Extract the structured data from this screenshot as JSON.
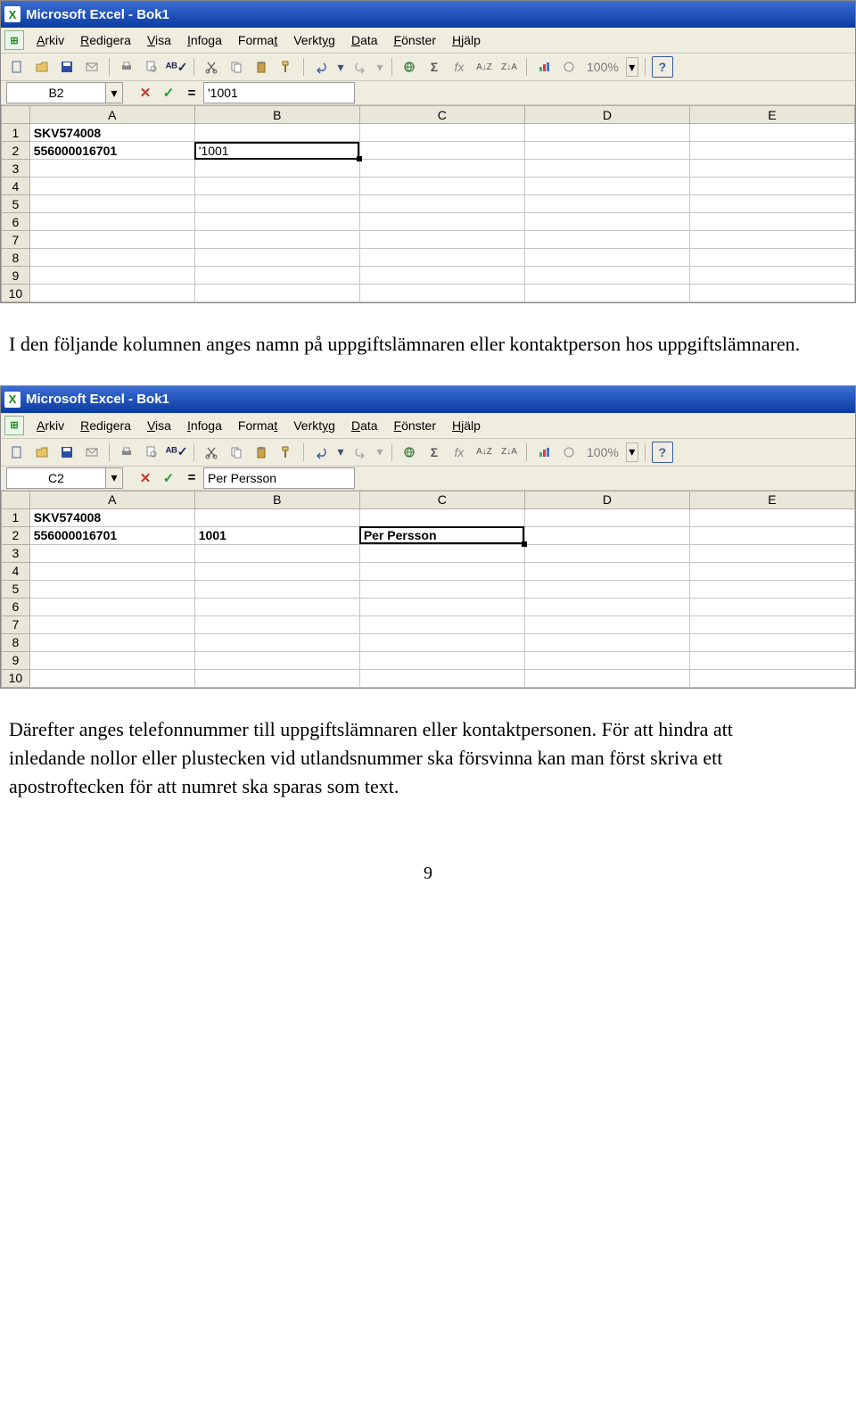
{
  "excel1": {
    "title": "Microsoft Excel - Bok1",
    "menus": [
      "Arkiv",
      "Redigera",
      "Visa",
      "Infoga",
      "Format",
      "Verktyg",
      "Data",
      "Fönster",
      "Hjälp"
    ],
    "zoom": "100%",
    "namebox": "B2",
    "formula": "'1001",
    "columns": [
      "A",
      "B",
      "C",
      "D",
      "E"
    ],
    "rows": [
      "1",
      "2",
      "3",
      "4",
      "5",
      "6",
      "7",
      "8",
      "9",
      "10"
    ],
    "cells": {
      "A1": "SKV574008",
      "A2": "556000016701",
      "B2": "'1001"
    },
    "active": "B2"
  },
  "para1": "I den följande kolumnen anges namn på uppgiftslämnaren eller kontaktperson hos uppgiftslämnaren.",
  "excel2": {
    "title": "Microsoft Excel - Bok1",
    "menus": [
      "Arkiv",
      "Redigera",
      "Visa",
      "Infoga",
      "Format",
      "Verktyg",
      "Data",
      "Fönster",
      "Hjälp"
    ],
    "zoom": "100%",
    "namebox": "C2",
    "formula": "Per Persson",
    "columns": [
      "A",
      "B",
      "C",
      "D",
      "E"
    ],
    "rows": [
      "1",
      "2",
      "3",
      "4",
      "5",
      "6",
      "7",
      "8",
      "9",
      "10"
    ],
    "cells": {
      "A1": "SKV574008",
      "A2": "556000016701",
      "B2": "1001",
      "C2": "Per Persson"
    },
    "active": "C2"
  },
  "para2": "Därefter anges telefonnummer till uppgiftslämnaren eller kontaktpersonen. För att hindra att inledande nollor eller plustecken vid utlandsnummer ska försvinna kan man först skriva ett apostroftecken för att numret ska sparas som text.",
  "page_number": "9"
}
